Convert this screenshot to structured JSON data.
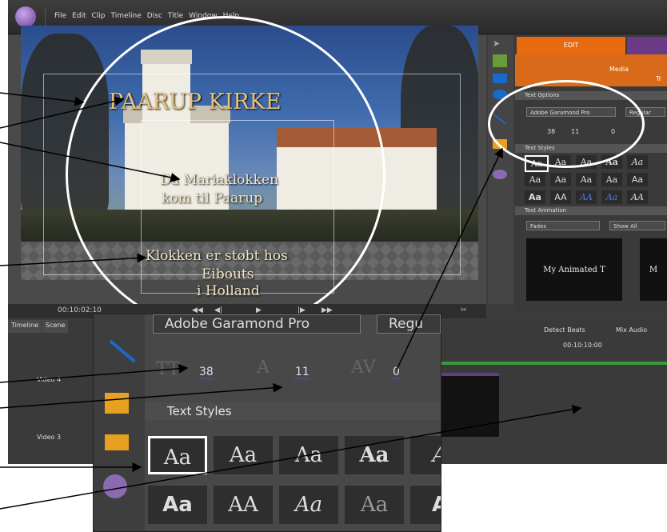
{
  "menubar": {
    "items": [
      "File",
      "Edit",
      "Clip",
      "Timeline",
      "Disc",
      "Title",
      "Window",
      "Help"
    ]
  },
  "monitor": {
    "title_text": "PAARUP KIRKE",
    "line1": "Da Mariaklokken",
    "line2": "kom til Paarup",
    "line3": "Klokken er støbt hos",
    "line4": "Eibouts",
    "line5": "i Holland",
    "timecode": "00:10:02:10"
  },
  "panel": {
    "edit_tab": "EDIT",
    "media_label": "Media",
    "tr_label": "Tr",
    "text_options_heading": "Text Options",
    "font": "Adobe Garamond Pro",
    "style": "Regular",
    "size": "38",
    "leading": "11",
    "kerning": "0",
    "text_styles_heading": "Text Styles",
    "swatches": [
      "Aa",
      "Aa",
      "Aa",
      "Aa",
      "Aa",
      "Aa",
      "Aa",
      "Aa",
      "Aa",
      "Aa",
      "Aa",
      "AA",
      "AA",
      "Aa",
      "AA"
    ],
    "text_animation_heading": "Text Animation",
    "anim_category": "Fades",
    "anim_filter": "Show All",
    "anim_preview_1": "My Animated T",
    "anim_preview_2": "M"
  },
  "timeline": {
    "tab_timeline": "Timeline",
    "tab_scene": "Scene",
    "detect_beats": "Detect Beats",
    "mix_audio": "Mix Audio",
    "timecode": "00:10:10:00",
    "track_video4": "Video 4",
    "track_video3": "Video 3"
  },
  "zoom": {
    "font": "Adobe Garamond Pro",
    "style": "Regu",
    "size": "38",
    "leading": "11",
    "kerning": "0",
    "heading": "Text Styles",
    "swatches_row1": [
      "Aa",
      "Aa",
      "Aa",
      "Aa",
      "A"
    ],
    "swatches_row2": [
      "Aa",
      "AA",
      "Aa",
      "Aa",
      "A"
    ]
  },
  "colors": {
    "accent_orange": "#e86a10",
    "purple": "#6a3a86",
    "title_gold": "#e8c27a"
  }
}
